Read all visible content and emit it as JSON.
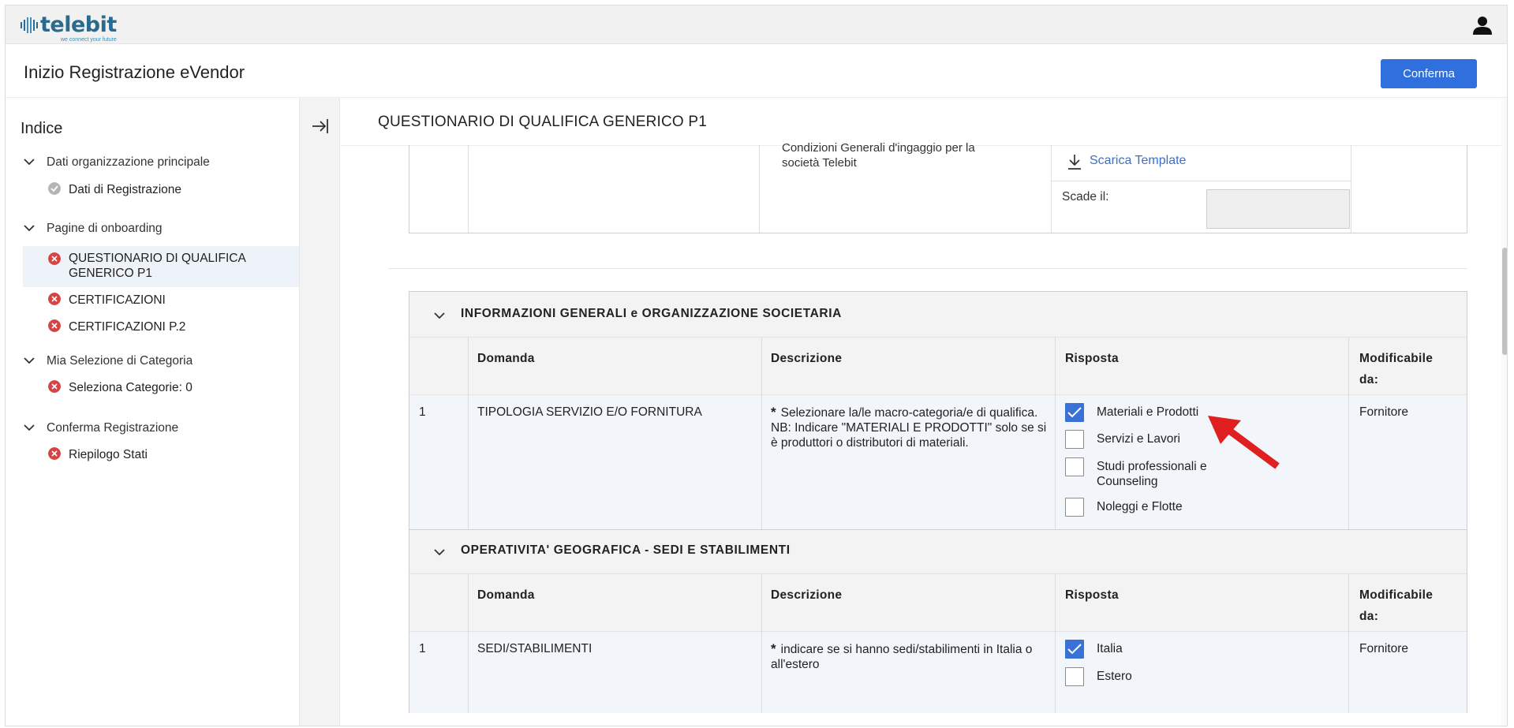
{
  "app": {
    "logo_text": "telebit",
    "logo_tagline": "we connect your future",
    "title": "Inizio Registrazione eVendor",
    "confirm_label": "Conferma",
    "colors": {
      "accent": "#2f6fde",
      "error": "#d64545",
      "done": "#b5b5b5"
    }
  },
  "sidebar": {
    "title": "Indice",
    "groups": [
      {
        "label": "Dati organizzazione principale",
        "items": [
          {
            "label": "Dati di Registrazione",
            "status": "done"
          }
        ]
      },
      {
        "label": "Pagine di onboarding",
        "items": [
          {
            "label": "QUESTIONARIO DI QUALIFICA GENERICO P1",
            "status": "error"
          },
          {
            "label": "CERTIFICAZIONI",
            "status": "error"
          },
          {
            "label": "CERTIFICAZIONI P.2",
            "status": "error"
          }
        ]
      },
      {
        "label": "Mia Selezione di Categoria",
        "items": [
          {
            "label": "Seleziona Categorie: 0",
            "status": "error"
          }
        ]
      },
      {
        "label": "Conferma Registrazione",
        "items": [
          {
            "label": "Riepilogo Stati",
            "status": "error"
          }
        ]
      }
    ]
  },
  "main": {
    "section_title": "QUESTIONARIO DI QUALIFICA GENERICO P1",
    "top_card": {
      "description": "Condizioni Generali d'ingaggio per la società Telebit",
      "download_label": "Scarica Template",
      "expiry_label": "Scade il:",
      "expiry_value": ""
    },
    "blocks": [
      {
        "title": "INFORMAZIONI GENERALI e ORGANIZZAZIONE SOCIETARIA",
        "headers": {
          "domanda": "Domanda",
          "descrizione": "Descrizione",
          "risposta": "Risposta",
          "modificabile_1": "Modificabile",
          "modificabile_2": "da:"
        },
        "row": {
          "num": "1",
          "question": "TIPOLOGIA SERVIZIO E/O FORNITURA",
          "required_mark": "*",
          "description_1": "Selezionare la/le macro-categoria/e di qualifica.",
          "description_2": "NB: Indicare \"MATERIALI E PRODOTTI\" solo se si è produttori o distributori di materiali.",
          "options": [
            {
              "label": "Materiali e Prodotti",
              "checked": true
            },
            {
              "label": "Servizi e Lavori",
              "checked": false
            },
            {
              "label": "Studi professionali e Counseling",
              "checked": false
            },
            {
              "label": "Noleggi e Flotte",
              "checked": false
            }
          ],
          "editable_by": "Fornitore"
        }
      },
      {
        "title": "OPERATIVITA' GEOGRAFICA - SEDI E STABILIMENTI",
        "headers": {
          "domanda": "Domanda",
          "descrizione": "Descrizione",
          "risposta": "Risposta",
          "modificabile_1": "Modificabile",
          "modificabile_2": "da:"
        },
        "row": {
          "num": "1",
          "question": "SEDI/STABILIMENTI",
          "required_mark": "*",
          "description_1": "indicare se si hanno sedi/stabilimenti in Italia o all'estero",
          "options": [
            {
              "label": "Italia",
              "checked": true
            },
            {
              "label": "Estero",
              "checked": false
            }
          ],
          "editable_by": "Fornitore"
        }
      }
    ]
  }
}
